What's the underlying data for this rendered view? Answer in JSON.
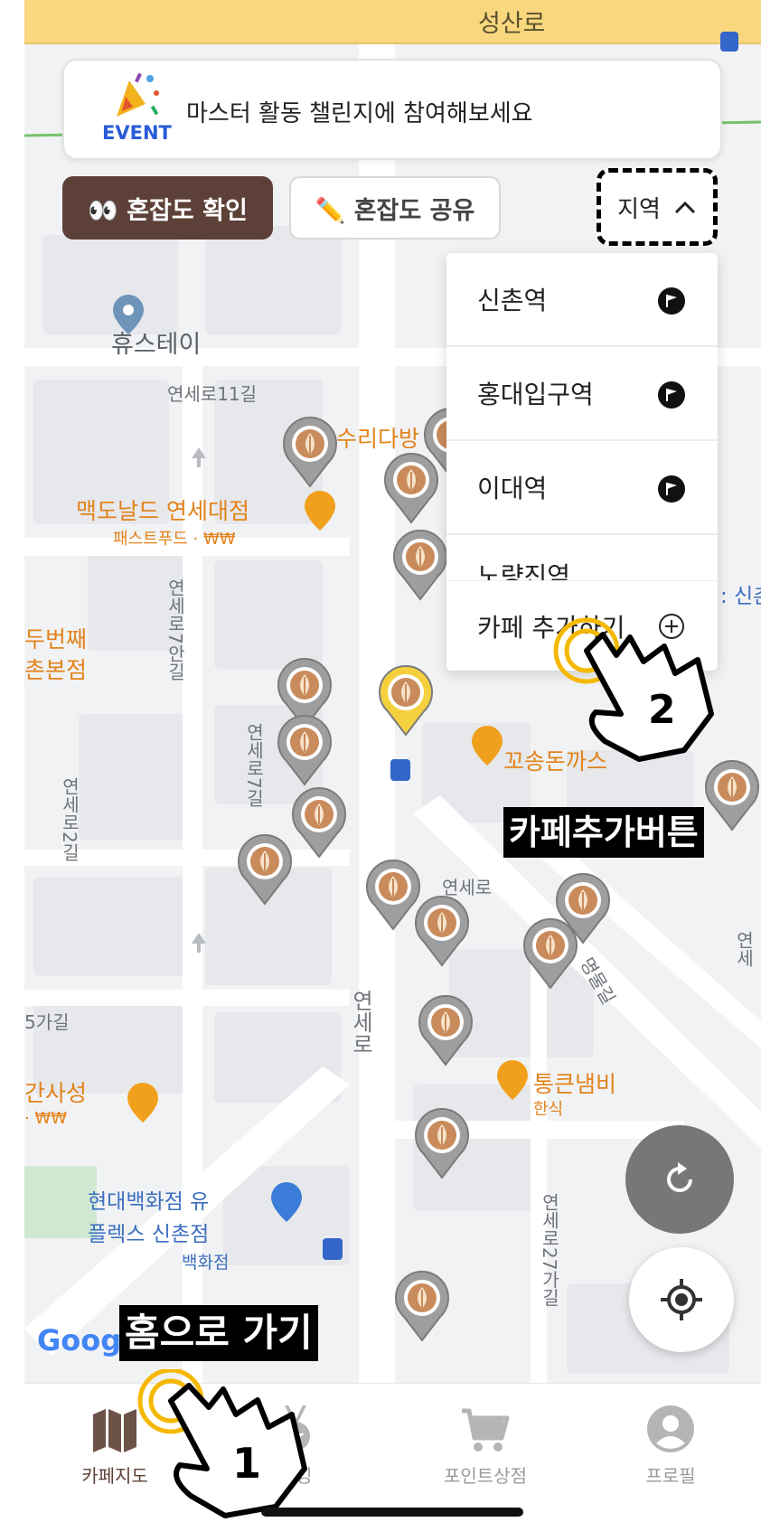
{
  "map": {
    "road_top": "성산로",
    "places": {
      "hustay": "휴스테이",
      "yonseiro11": "연세로11길",
      "suri_dabang": "수리다방",
      "mcdonalds": "맥도날드 연세대점",
      "mcdonalds_sub": "패스트푸드 · ₩₩",
      "dubeonjjae_1": "두번째",
      "dubeonjjae_2": "촌본점",
      "yonseiro7an": "연세로7안길",
      "yonseiro7": "연세로7길",
      "yonseiro2": "연세로2길",
      "kkosong": "꼬송돈까스",
      "yonseiro_a": "연세로",
      "yonseiro_b": "연세로",
      "myeongmul": "명물길",
      "ga5": "5가길",
      "gansaseong": "간사성",
      "gansaseong_sub": "· ₩₩",
      "tongkeun": "통큰냄비",
      "tongkeun_sub": "한식",
      "hyundai_1": "현대백화점 유",
      "hyundai_2": "플렉스 신촌점",
      "hyundai_sub": "백화점",
      "yonseiro27": "연세로27가길",
      "shin_edge": ": 신촌",
      "yonse_edge": "연세",
      "google": "Goog"
    }
  },
  "event": {
    "icon_label": "EVENT",
    "text": "마스터 활동 챌린지에 참여해보세요"
  },
  "buttons": {
    "check": "👀 혼잡도 확인",
    "share": "✏️ 혼잡도 공유",
    "region": "지역"
  },
  "region_menu": {
    "items": [
      "신촌역",
      "홍대입구역",
      "이대역",
      "노량진역"
    ],
    "add_cafe": "카페 추가하기"
  },
  "annotations": {
    "add_cafe_caption": "카페추가버튼",
    "home_caption": "홈으로 가기",
    "step1": "1",
    "step2": "2"
  },
  "nav": {
    "tabs": [
      "카페지도",
      "랭킹",
      "포인트상점",
      "프로필"
    ],
    "active_index": 0
  },
  "colors": {
    "primary_brown": "#5d4037",
    "food_orange": "#e2831b",
    "pin_gray": "#9e9e9e",
    "pin_selected": "#f4d03f",
    "annotation_yellow": "#f5b800"
  }
}
